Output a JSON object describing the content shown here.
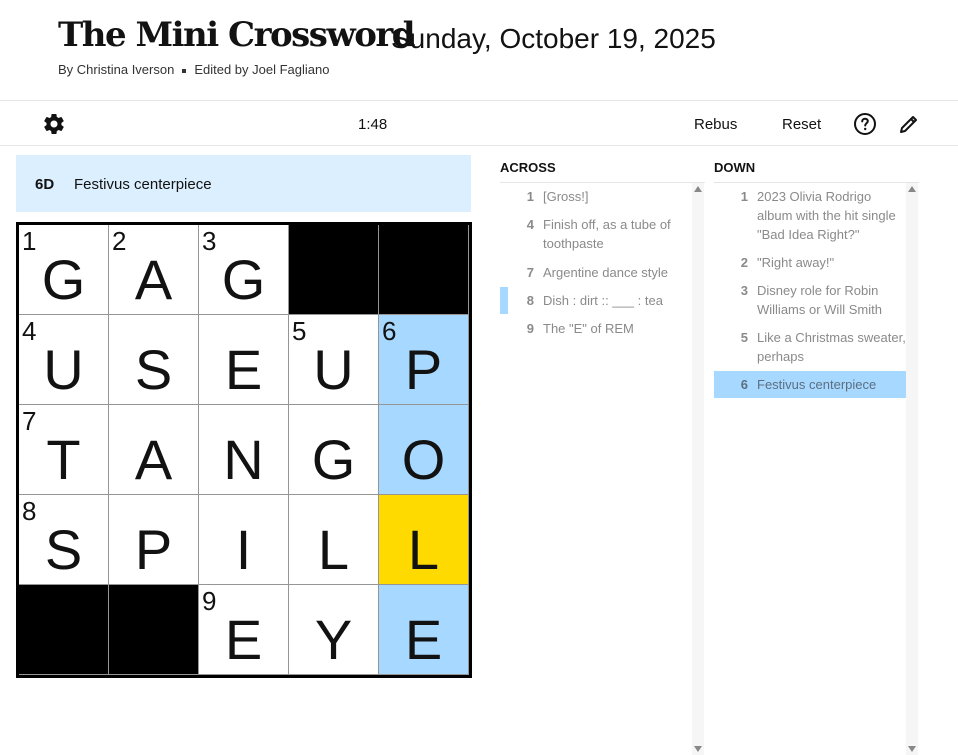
{
  "header": {
    "title": "The Mini Crossword",
    "date": "Sunday, October 19, 2025",
    "author": "By Christina Iverson",
    "editor": "Edited by Joel Fagliano"
  },
  "toolbar": {
    "timer": "1:48",
    "rebus_label": "Rebus",
    "reset_label": "Reset",
    "settings_icon": "gear-icon",
    "help_icon": "help-icon",
    "pencil_icon": "pencil-icon"
  },
  "clue_bar": {
    "number": "6D",
    "text": "Festivus centerpiece"
  },
  "colors": {
    "highlight": "#a7d8ff",
    "selected": "#ffda00",
    "clue_bar": "#dcefff"
  },
  "grid": {
    "rows": [
      [
        {
          "n": "1",
          "l": "G",
          "s": ""
        },
        {
          "n": "2",
          "l": "A",
          "s": ""
        },
        {
          "n": "3",
          "l": "G",
          "s": ""
        },
        {
          "n": "",
          "l": "",
          "s": "black"
        },
        {
          "n": "",
          "l": "",
          "s": "black"
        }
      ],
      [
        {
          "n": "4",
          "l": "U",
          "s": ""
        },
        {
          "n": "",
          "l": "S",
          "s": ""
        },
        {
          "n": "",
          "l": "E",
          "s": ""
        },
        {
          "n": "5",
          "l": "U",
          "s": ""
        },
        {
          "n": "6",
          "l": "P",
          "s": "hl"
        }
      ],
      [
        {
          "n": "7",
          "l": "T",
          "s": ""
        },
        {
          "n": "",
          "l": "A",
          "s": ""
        },
        {
          "n": "",
          "l": "N",
          "s": ""
        },
        {
          "n": "",
          "l": "G",
          "s": ""
        },
        {
          "n": "",
          "l": "O",
          "s": "hl"
        }
      ],
      [
        {
          "n": "8",
          "l": "S",
          "s": ""
        },
        {
          "n": "",
          "l": "P",
          "s": ""
        },
        {
          "n": "",
          "l": "I",
          "s": ""
        },
        {
          "n": "",
          "l": "L",
          "s": ""
        },
        {
          "n": "",
          "l": "L",
          "s": "sel"
        }
      ],
      [
        {
          "n": "",
          "l": "",
          "s": "black"
        },
        {
          "n": "",
          "l": "",
          "s": "black"
        },
        {
          "n": "9",
          "l": "E",
          "s": ""
        },
        {
          "n": "",
          "l": "Y",
          "s": ""
        },
        {
          "n": "",
          "l": "E",
          "s": "hl"
        }
      ]
    ]
  },
  "across": {
    "heading": "ACROSS",
    "clues": [
      {
        "num": "1",
        "text": "[Gross!]"
      },
      {
        "num": "4",
        "text": "Finish off, as a tube of toothpaste"
      },
      {
        "num": "7",
        "text": "Argentine dance style"
      },
      {
        "num": "8",
        "text": "Dish : dirt :: ___ : tea"
      },
      {
        "num": "9",
        "text": "The \"E\" of REM"
      }
    ]
  },
  "down": {
    "heading": "DOWN",
    "clues": [
      {
        "num": "1",
        "text": "2023 Olivia Rodrigo album with the hit single \"Bad Idea Right?\""
      },
      {
        "num": "2",
        "text": "\"Right away!\""
      },
      {
        "num": "3",
        "text": "Disney role for Robin Williams or Will Smith"
      },
      {
        "num": "5",
        "text": "Like a Christmas sweater, perhaps"
      },
      {
        "num": "6",
        "text": "Festivus centerpiece"
      }
    ]
  }
}
